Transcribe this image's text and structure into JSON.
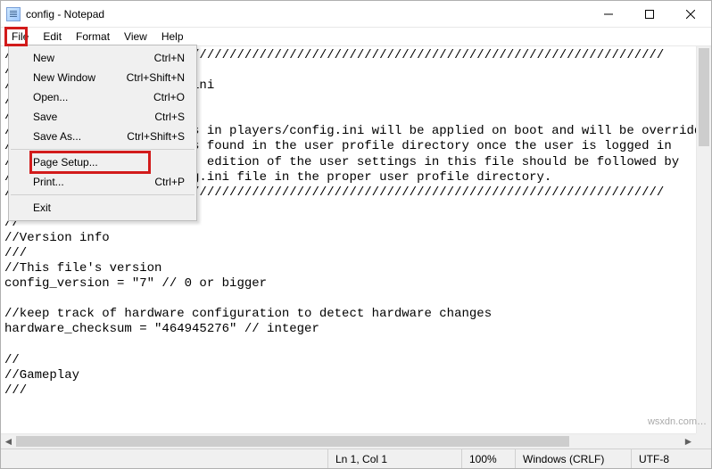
{
  "window": {
    "title": "config - Notepad"
  },
  "menubar": {
    "file": "File",
    "edit": "Edit",
    "format": "Format",
    "view": "View",
    "help": "Help"
  },
  "file_menu": {
    "new_label": "New",
    "new_sc": "Ctrl+N",
    "newwin_label": "New Window",
    "newwin_sc": "Ctrl+Shift+N",
    "open_label": "Open...",
    "open_sc": "Ctrl+O",
    "save_label": "Save",
    "save_sc": "Ctrl+S",
    "saveas_label": "Save As...",
    "saveas_sc": "Ctrl+Shift+S",
    "pagesetup_label": "Page Setup...",
    "print_label": "Print...",
    "print_sc": "Ctrl+P",
    "exit_label": "Exit"
  },
  "editor": {
    "content": "////////////////////////////////////////////////////////////////////////////////////////\n//\n//        players/config.ini\n//\n//\n//    The default settings in players/config.ini will be applied on boot and will be overridden.\n//    by the user settings found in the user profile directory once the user is logged in\n//    As much as possible, edition of the user settings in this file should be followed by\n//    a copy of the config.ini file in the proper user profile directory.\n////////////////////////////////////////////////////////////////////////////////////////\n\n//\n//Version info\n///\n//This file's version\nconfig_version = \"7\" // 0 or bigger\n\n//keep track of hardware configuration to detect hardware changes\nhardware_checksum = \"464945276\" // integer\n\n//\n//Gameplay\n///"
  },
  "statusbar": {
    "position": "Ln 1, Col 1",
    "zoom": "100%",
    "line_ending": "Windows (CRLF)",
    "encoding": "UTF-8"
  },
  "watermark": "wsxdn.com…"
}
